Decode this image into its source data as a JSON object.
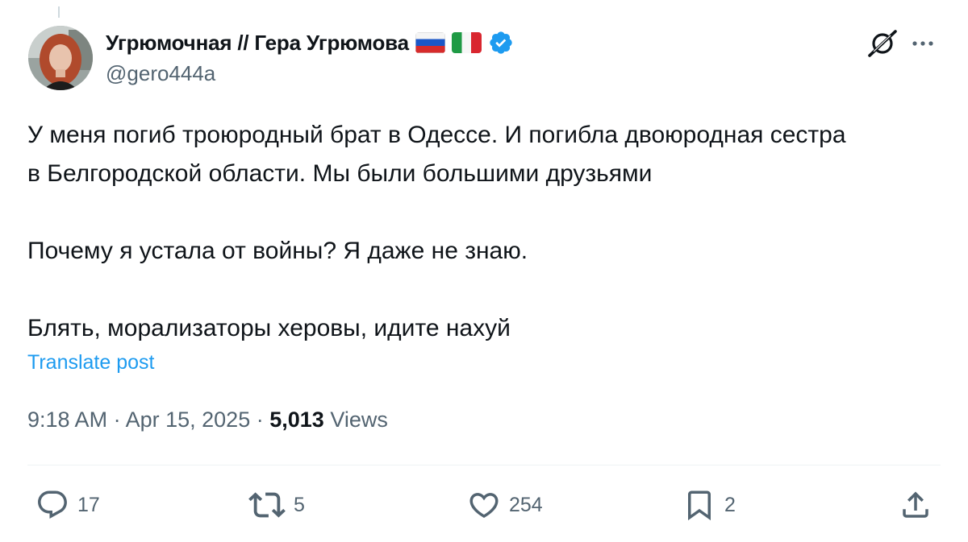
{
  "tweet": {
    "display_name": "Угрюмочная // Гера Угрюмова",
    "handle": "@gero444a",
    "flags": [
      "russia-flag",
      "italy-flag"
    ],
    "verified_icon": "verified-badge-icon",
    "text_lines": [
      "У меня погиб троюродный брат в Одессе. И погибла двоюродная сестра",
      "в Белгородской области. Мы были большими друзьями",
      "Почему я устала от войны? Я даже не знаю.",
      "Блять, морализаторы херовы, идите нахуй"
    ],
    "translate_label": "Translate post",
    "time": "9:18 AM",
    "separator": "·",
    "date": "Apr 15, 2025",
    "views_count": "5,013",
    "views_label": "Views"
  },
  "header_icons": {
    "grok": "grok-icon",
    "more": "more-icon"
  },
  "actions": {
    "reply": {
      "icon": "reply-icon",
      "count": "17"
    },
    "retweet": {
      "icon": "retweet-icon",
      "count": "5"
    },
    "like": {
      "icon": "like-icon",
      "count": "254"
    },
    "bookmark": {
      "icon": "bookmark-icon",
      "count": "2"
    },
    "share": {
      "icon": "share-icon"
    }
  },
  "colors": {
    "text": "#0f1419",
    "secondary": "#536471",
    "accent": "#1d9bf0",
    "divider": "#eff3f4"
  }
}
